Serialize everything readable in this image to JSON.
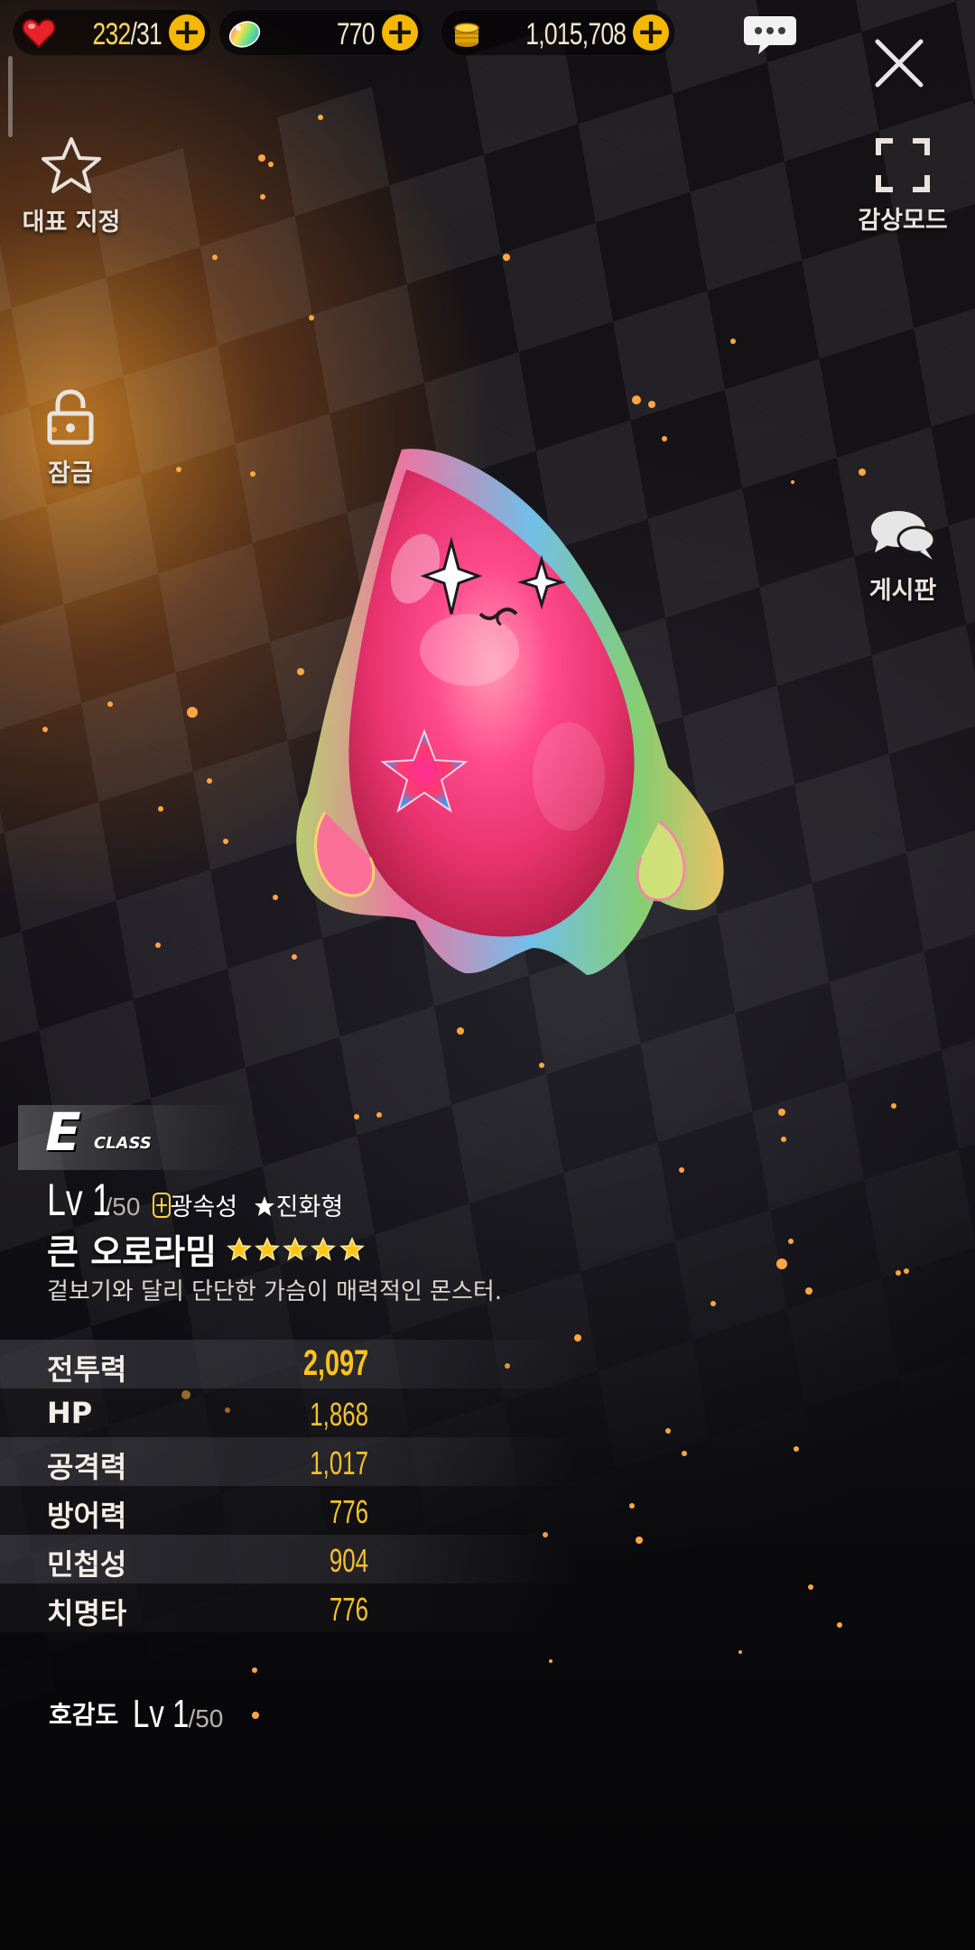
{
  "resources": {
    "lives_current": "232",
    "lives_max": "/31",
    "gems": "770",
    "gold": "1,015,708",
    "plus_icon": "plus-circle-icon"
  },
  "side_buttons": {
    "set_representative": "대표 지정",
    "view_mode": "감상모드",
    "lock": "잠금",
    "board": "게시판"
  },
  "monster": {
    "class_letter": "E",
    "class_word": "CLASS",
    "level": "Lv 1",
    "level_max": "/50",
    "attribute": "광속성",
    "type": "진화형",
    "name": "큰 오로라밈",
    "star_count": 5,
    "description": "겉보기와 달리 단단한 가슴이 매력적인 몬스터."
  },
  "stats": [
    {
      "label": "전투력",
      "value": "2,097"
    },
    {
      "label": "HP",
      "value": "1,868"
    },
    {
      "label": "공격력",
      "value": "1,017"
    },
    {
      "label": "방어력",
      "value": "776"
    },
    {
      "label": "민첩성",
      "value": "904"
    },
    {
      "label": "치명타",
      "value": "776"
    }
  ],
  "affinity": {
    "label": "호감도",
    "level": "Lv 1",
    "max": "/50"
  },
  "colors": {
    "accent_gold": "#f5b800",
    "stat_value": "#f6c12a",
    "monster_pink": "#ff3d8a"
  }
}
